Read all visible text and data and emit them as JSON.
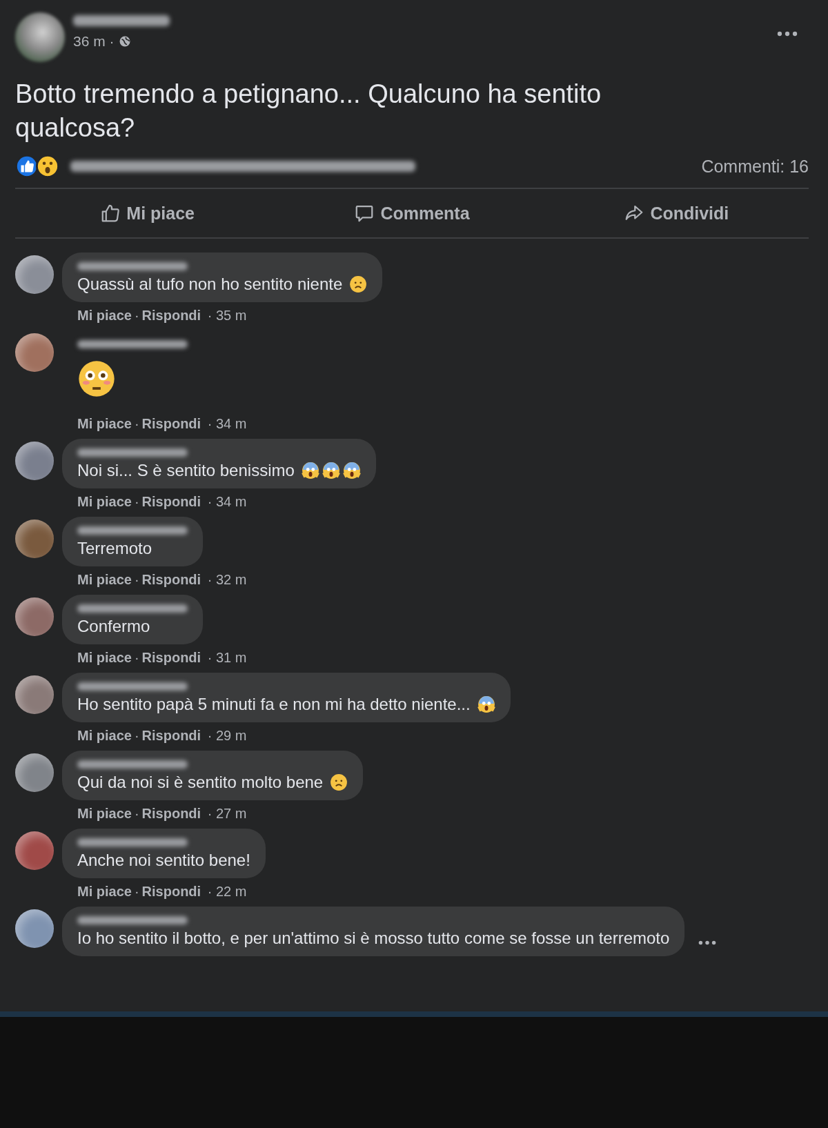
{
  "post": {
    "time": "36 m ·",
    "title": "Botto tremendo a petignano... Qualcuno ha sentito qualcosa?",
    "reactions": [
      {
        "kind": "like"
      },
      {
        "kind": "wow"
      }
    ],
    "comment_count": "Commenti: 16",
    "actions": [
      {
        "kind": "like",
        "label": "Mi piace"
      },
      {
        "kind": "comment",
        "label": "Commenta"
      },
      {
        "kind": "share",
        "label": "Condividi"
      }
    ]
  },
  "comments": [
    {
      "text": "Quassù al tufo non ho sentito niente",
      "emojis": [
        {
          "kind": "frown"
        }
      ],
      "like": "Mi piace",
      "separator": "·",
      "reply": "Rispondi",
      "time": "· 35 m"
    },
    {
      "big_emoji": {
        "kind": "flushed"
      },
      "like": "Mi piace",
      "separator": "·",
      "reply": "Rispondi",
      "time": "· 34 m"
    },
    {
      "text": "Noi si... S è sentito benissimo",
      "emojis": [
        {
          "kind": "scream"
        },
        {
          "kind": "scream"
        },
        {
          "kind": "scream"
        }
      ],
      "like": "Mi piace",
      "separator": "·",
      "reply": "Rispondi",
      "time": "· 34 m"
    },
    {
      "text": "Terremoto",
      "like": "Mi piace",
      "separator": "·",
      "reply": "Rispondi",
      "time": "· 32 m"
    },
    {
      "text": "Confermo",
      "like": "Mi piace",
      "separator": "·",
      "reply": "Rispondi",
      "time": "· 31 m"
    },
    {
      "text": "Ho sentito papà 5 minuti fa e non mi ha detto niente...",
      "emojis": [
        {
          "kind": "scream"
        }
      ],
      "like": "Mi piace",
      "separator": "·",
      "reply": "Rispondi",
      "time": "· 29 m"
    },
    {
      "text": "Qui da noi si è sentito molto bene",
      "emojis": [
        {
          "kind": "frown"
        }
      ],
      "like": "Mi piace",
      "separator": "·",
      "reply": "Rispondi",
      "time": "· 27 m"
    },
    {
      "text": "Anche noi sentito bene!",
      "like": "Mi piace",
      "separator": "·",
      "reply": "Rispondi",
      "time": "· 22 m"
    },
    {
      "text": "Io ho sentito il botto, e per un'attimo si è mosso tutto come se fosse un terremoto",
      "more": true
    }
  ]
}
